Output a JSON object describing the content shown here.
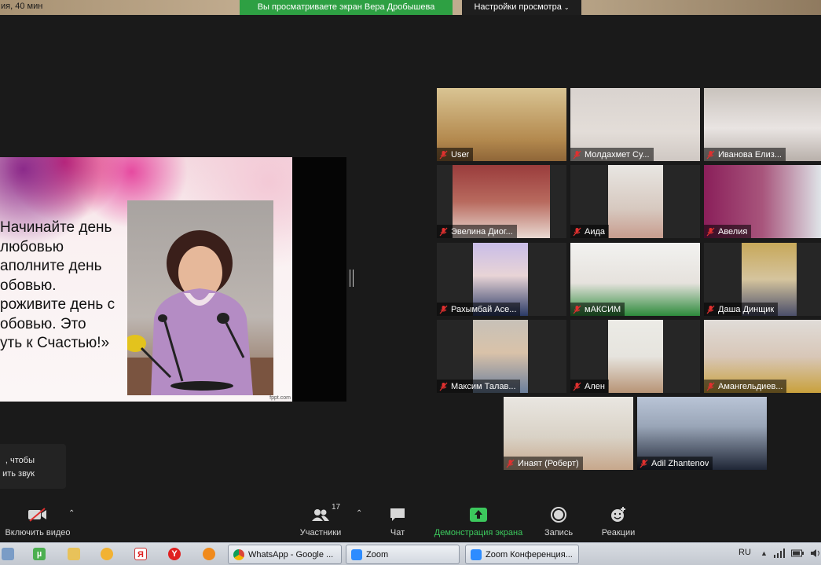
{
  "top": {
    "duration": "ия, 40 мин",
    "share_banner": "Вы просматриваете экран Вера Дробышева",
    "view_options": "Настройки просмотра",
    "view_options_icon": "chevron-down-icon"
  },
  "slide": {
    "quote": "Начинайте день\nлюбовью\nаполните день\nобовью.\nроживите день с\nобовью. Это\nуть к Счастью!»",
    "credit": "fppt.com"
  },
  "participants": [
    {
      "name": "User",
      "muted": true
    },
    {
      "name": "Молдахмет Су...",
      "muted": true
    },
    {
      "name": "Иванова Елиз...",
      "muted": true
    },
    {
      "name": "Эвелина Диог...",
      "muted": true
    },
    {
      "name": "Аида",
      "muted": true
    },
    {
      "name": "Авелия",
      "muted": true
    },
    {
      "name": "Рахымбай Асе...",
      "muted": true
    },
    {
      "name": "мАКСИМ",
      "muted": true
    },
    {
      "name": "Даша Динщик",
      "muted": true
    },
    {
      "name": "Максим Талав...",
      "muted": true
    },
    {
      "name": "Ален",
      "muted": true
    },
    {
      "name": "Амангельдиев...",
      "muted": true
    },
    {
      "name": "Инаят (Роберт)",
      "muted": true
    },
    {
      "name": "Adil Zhantenov",
      "muted": true
    }
  ],
  "unmute_hint": {
    "line1": ", чтобы",
    "line2": "ить звук"
  },
  "toolbar": {
    "video_label": "Включить видео",
    "participants_label": "Участники",
    "participants_count": "17",
    "chat_label": "Чат",
    "share_label": "Демонстрация экрана",
    "record_label": "Запись",
    "reactions_label": "Реакции",
    "accent_color": "#3cc85d",
    "mute_color": "#e0302f"
  },
  "taskbar": {
    "tasks": [
      {
        "label": "WhatsApp - Google ...",
        "icon": "chrome-icon"
      },
      {
        "label": "Zoom",
        "icon": "zoom-icon"
      },
      {
        "label": "Zoom Конференция...",
        "icon": "zoom-icon"
      }
    ],
    "language": "RU"
  }
}
